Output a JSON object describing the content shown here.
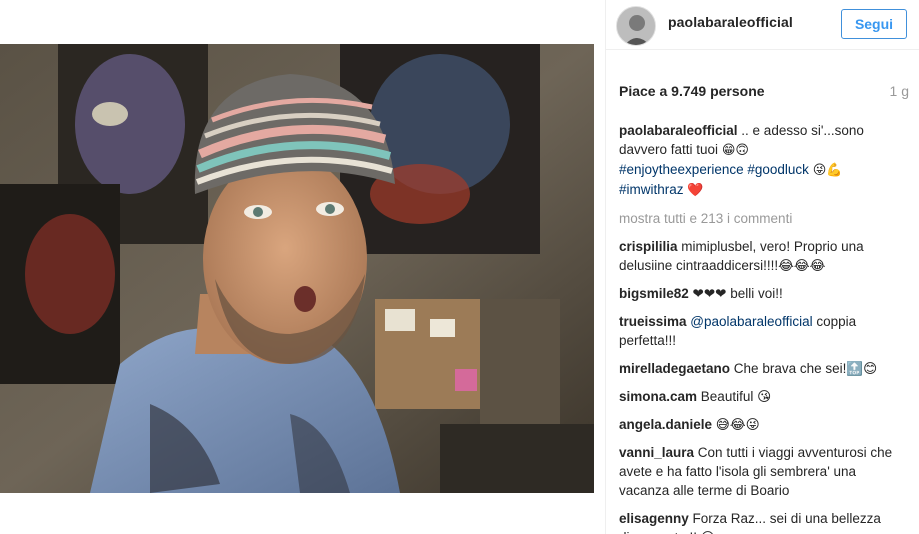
{
  "post": {
    "username": "paolabaraleofficial",
    "follow_label": "Segui",
    "likes_text": "Piace a 9.749 persone",
    "age_text": "1 g",
    "caption": {
      "user": "paolabaraleofficial",
      "text": " .. e adesso si'...sono davvero fatti tuoi ",
      "emoji1": "😁🙃",
      "tag1": "#enjoytheexperience",
      "tag2": "#goodluck",
      "emoji2": "😜💪",
      "tag3": "#imwithraz",
      "emoji3": "❤️"
    },
    "show_all": "mostra tutti e 213 i commenti"
  },
  "comments": [
    {
      "user": "crispililia",
      "text": " mimiplusbel, vero! Proprio una delusiine cintraaddicersi!!!!😂😂😂"
    },
    {
      "user": "bigsmile82",
      "text": " ❤❤❤ belli voi!!"
    },
    {
      "user": "trueissima",
      "mention": " @paolabaraleofficial",
      "text": " coppia perfetta!!!"
    },
    {
      "user": "mirelladegaetano",
      "text": " Che brava che sei!🔝😊"
    },
    {
      "user": "simona.cam",
      "text": " Beautiful 😘"
    },
    {
      "user": "angela.daniele",
      "text": " 😅😂😜"
    },
    {
      "user": "vanni_laura",
      "text": " Con tutti i viaggi avventurosi che avete e ha fatto l'isola gli sembrera' una vacanza alle terme di Boario"
    },
    {
      "user": "elisagenny",
      "text": " Forza Raz... sei di una bellezza disarmante !! 😍"
    }
  ],
  "colors": {
    "link_blue": "#3897f0",
    "tag_blue": "#003569",
    "muted": "#999999"
  }
}
